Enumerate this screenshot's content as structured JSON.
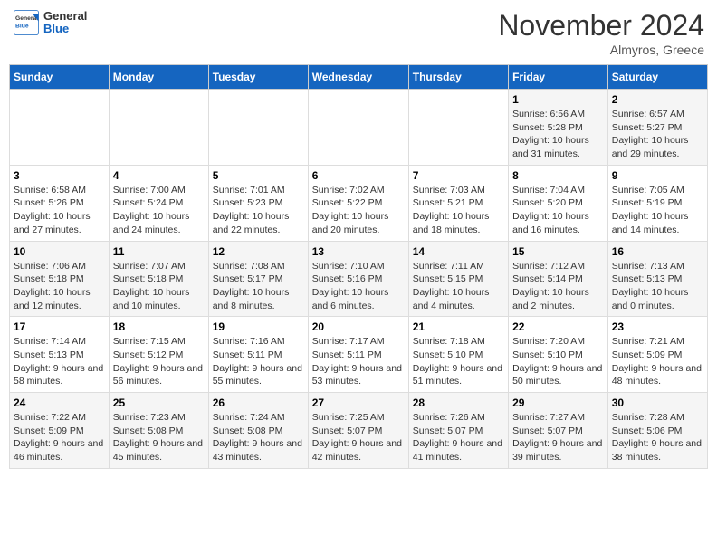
{
  "header": {
    "logo_general": "General",
    "logo_blue": "Blue",
    "month_title": "November 2024",
    "location": "Almyros, Greece"
  },
  "weekdays": [
    "Sunday",
    "Monday",
    "Tuesday",
    "Wednesday",
    "Thursday",
    "Friday",
    "Saturday"
  ],
  "weeks": [
    [
      {
        "day": "",
        "info": ""
      },
      {
        "day": "",
        "info": ""
      },
      {
        "day": "",
        "info": ""
      },
      {
        "day": "",
        "info": ""
      },
      {
        "day": "",
        "info": ""
      },
      {
        "day": "1",
        "info": "Sunrise: 6:56 AM\nSunset: 5:28 PM\nDaylight: 10 hours and 31 minutes."
      },
      {
        "day": "2",
        "info": "Sunrise: 6:57 AM\nSunset: 5:27 PM\nDaylight: 10 hours and 29 minutes."
      }
    ],
    [
      {
        "day": "3",
        "info": "Sunrise: 6:58 AM\nSunset: 5:26 PM\nDaylight: 10 hours and 27 minutes."
      },
      {
        "day": "4",
        "info": "Sunrise: 7:00 AM\nSunset: 5:24 PM\nDaylight: 10 hours and 24 minutes."
      },
      {
        "day": "5",
        "info": "Sunrise: 7:01 AM\nSunset: 5:23 PM\nDaylight: 10 hours and 22 minutes."
      },
      {
        "day": "6",
        "info": "Sunrise: 7:02 AM\nSunset: 5:22 PM\nDaylight: 10 hours and 20 minutes."
      },
      {
        "day": "7",
        "info": "Sunrise: 7:03 AM\nSunset: 5:21 PM\nDaylight: 10 hours and 18 minutes."
      },
      {
        "day": "8",
        "info": "Sunrise: 7:04 AM\nSunset: 5:20 PM\nDaylight: 10 hours and 16 minutes."
      },
      {
        "day": "9",
        "info": "Sunrise: 7:05 AM\nSunset: 5:19 PM\nDaylight: 10 hours and 14 minutes."
      }
    ],
    [
      {
        "day": "10",
        "info": "Sunrise: 7:06 AM\nSunset: 5:18 PM\nDaylight: 10 hours and 12 minutes."
      },
      {
        "day": "11",
        "info": "Sunrise: 7:07 AM\nSunset: 5:18 PM\nDaylight: 10 hours and 10 minutes."
      },
      {
        "day": "12",
        "info": "Sunrise: 7:08 AM\nSunset: 5:17 PM\nDaylight: 10 hours and 8 minutes."
      },
      {
        "day": "13",
        "info": "Sunrise: 7:10 AM\nSunset: 5:16 PM\nDaylight: 10 hours and 6 minutes."
      },
      {
        "day": "14",
        "info": "Sunrise: 7:11 AM\nSunset: 5:15 PM\nDaylight: 10 hours and 4 minutes."
      },
      {
        "day": "15",
        "info": "Sunrise: 7:12 AM\nSunset: 5:14 PM\nDaylight: 10 hours and 2 minutes."
      },
      {
        "day": "16",
        "info": "Sunrise: 7:13 AM\nSunset: 5:13 PM\nDaylight: 10 hours and 0 minutes."
      }
    ],
    [
      {
        "day": "17",
        "info": "Sunrise: 7:14 AM\nSunset: 5:13 PM\nDaylight: 9 hours and 58 minutes."
      },
      {
        "day": "18",
        "info": "Sunrise: 7:15 AM\nSunset: 5:12 PM\nDaylight: 9 hours and 56 minutes."
      },
      {
        "day": "19",
        "info": "Sunrise: 7:16 AM\nSunset: 5:11 PM\nDaylight: 9 hours and 55 minutes."
      },
      {
        "day": "20",
        "info": "Sunrise: 7:17 AM\nSunset: 5:11 PM\nDaylight: 9 hours and 53 minutes."
      },
      {
        "day": "21",
        "info": "Sunrise: 7:18 AM\nSunset: 5:10 PM\nDaylight: 9 hours and 51 minutes."
      },
      {
        "day": "22",
        "info": "Sunrise: 7:20 AM\nSunset: 5:10 PM\nDaylight: 9 hours and 50 minutes."
      },
      {
        "day": "23",
        "info": "Sunrise: 7:21 AM\nSunset: 5:09 PM\nDaylight: 9 hours and 48 minutes."
      }
    ],
    [
      {
        "day": "24",
        "info": "Sunrise: 7:22 AM\nSunset: 5:09 PM\nDaylight: 9 hours and 46 minutes."
      },
      {
        "day": "25",
        "info": "Sunrise: 7:23 AM\nSunset: 5:08 PM\nDaylight: 9 hours and 45 minutes."
      },
      {
        "day": "26",
        "info": "Sunrise: 7:24 AM\nSunset: 5:08 PM\nDaylight: 9 hours and 43 minutes."
      },
      {
        "day": "27",
        "info": "Sunrise: 7:25 AM\nSunset: 5:07 PM\nDaylight: 9 hours and 42 minutes."
      },
      {
        "day": "28",
        "info": "Sunrise: 7:26 AM\nSunset: 5:07 PM\nDaylight: 9 hours and 41 minutes."
      },
      {
        "day": "29",
        "info": "Sunrise: 7:27 AM\nSunset: 5:07 PM\nDaylight: 9 hours and 39 minutes."
      },
      {
        "day": "30",
        "info": "Sunrise: 7:28 AM\nSunset: 5:06 PM\nDaylight: 9 hours and 38 minutes."
      }
    ]
  ]
}
